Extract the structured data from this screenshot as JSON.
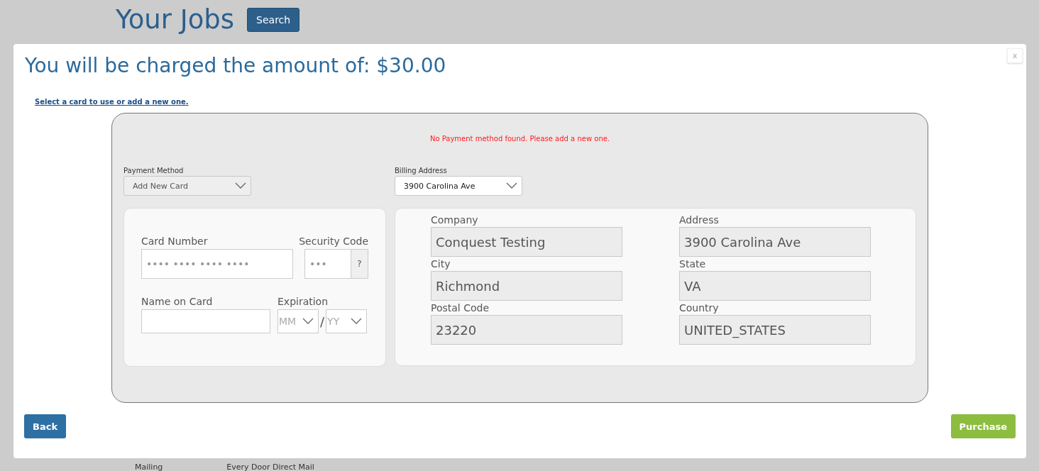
{
  "page": {
    "title": "Your Jobs",
    "search_button": "Search"
  },
  "background_row": [
    "Mailing",
    "Every Door Direct Mail"
  ],
  "modal": {
    "title": "You will be charged the amount of: $30.00",
    "close": "x",
    "instruction_link": "Select a card to use or add a new one.",
    "error": "No Payment method found. Please add a new one.",
    "payment_method": {
      "label": "Payment Method",
      "value": "Add New Card",
      "disabled": true
    },
    "billing_address": {
      "label": "Billing Address",
      "value": "3900 Carolina Ave",
      "disabled": false
    },
    "card": {
      "number_label": "Card Number",
      "number_placeholder": "•••• •••• •••• ••••",
      "security_label": "Security Code",
      "security_placeholder": "•••",
      "security_help": "?",
      "name_label": "Name on Card",
      "expiration_label": "Expiration",
      "month_placeholder": "MM",
      "separator": "/",
      "year_placeholder": "YY"
    },
    "address_fields": [
      {
        "label": "Company",
        "value": "Conquest Testing"
      },
      {
        "label": "Address",
        "value": "3900 Carolina Ave"
      },
      {
        "label": "City",
        "value": "Richmond"
      },
      {
        "label": "State",
        "value": "VA"
      },
      {
        "label": "Postal Code",
        "value": "23220"
      },
      {
        "label": "Country",
        "value": "UNITED_STATES"
      }
    ],
    "buttons": {
      "back": "Back",
      "purchase": "Purchase"
    }
  }
}
